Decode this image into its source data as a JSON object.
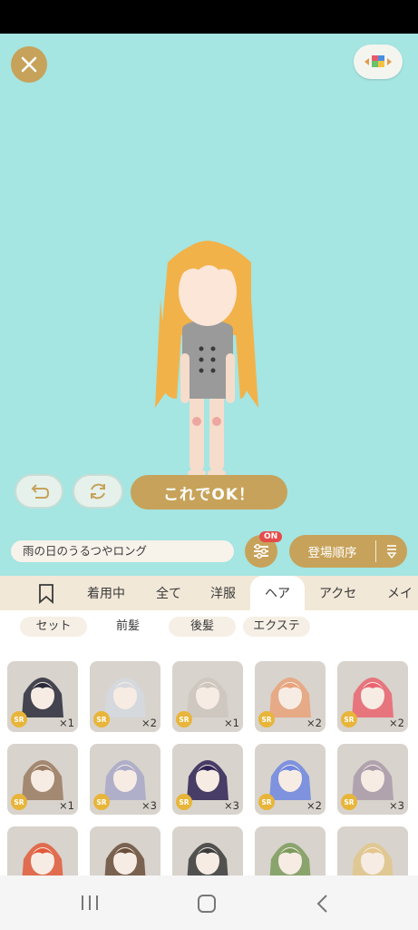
{
  "stage": {
    "close_icon": "close-icon",
    "view_icon": "color-blocks-icon",
    "ok_label": "これでOK！",
    "undo_icon": "undo-icon",
    "refresh_icon": "refresh-icon"
  },
  "item_name": "雨の日のうるつやロング",
  "filter": {
    "badge": "ON"
  },
  "sort": {
    "label": "登場順序"
  },
  "tabs": [
    "着用中",
    "全て",
    "洋服",
    "ヘア",
    "アクセ",
    "メイク"
  ],
  "active_tab": "ヘア",
  "subtabs": [
    "セット",
    "前髪",
    "後髪",
    "エクステ"
  ],
  "active_subtab": "前髪",
  "items": [
    {
      "rarity": "SR",
      "count": "×1",
      "hair": "#2a2a3a"
    },
    {
      "rarity": "SR",
      "count": "×2",
      "hair": "#d5d8de"
    },
    {
      "rarity": "SR",
      "count": "×1",
      "hair": "#cdc6be"
    },
    {
      "rarity": "SR",
      "count": "×2",
      "hair": "#e9a27a"
    },
    {
      "rarity": "SR",
      "count": "×2",
      "hair": "#ea6470"
    },
    {
      "rarity": "SR",
      "count": "×1",
      "hair": "#9a7a62"
    },
    {
      "rarity": "SR",
      "count": "×3",
      "hair": "#a9a8c8"
    },
    {
      "rarity": "SR",
      "count": "×3",
      "hair": "#2f2254"
    },
    {
      "rarity": "SR",
      "count": "×2",
      "hair": "#6e86e0"
    },
    {
      "rarity": "SR",
      "count": "×3",
      "hair": "#a99aa8"
    },
    {
      "rarity": "",
      "count": "",
      "hair": "#e25a3a"
    },
    {
      "rarity": "",
      "count": "",
      "hair": "#6a4e3a"
    },
    {
      "rarity": "",
      "count": "",
      "hair": "#3a3a3a"
    },
    {
      "rarity": "",
      "count": "",
      "hair": "#7c9b5c"
    },
    {
      "rarity": "",
      "count": "",
      "hair": "#e2c68a"
    }
  ],
  "colors": {
    "accent": "#c7a25a",
    "stage_bg": "#a5e5e2",
    "tab_bg": "#f2e8d8"
  }
}
